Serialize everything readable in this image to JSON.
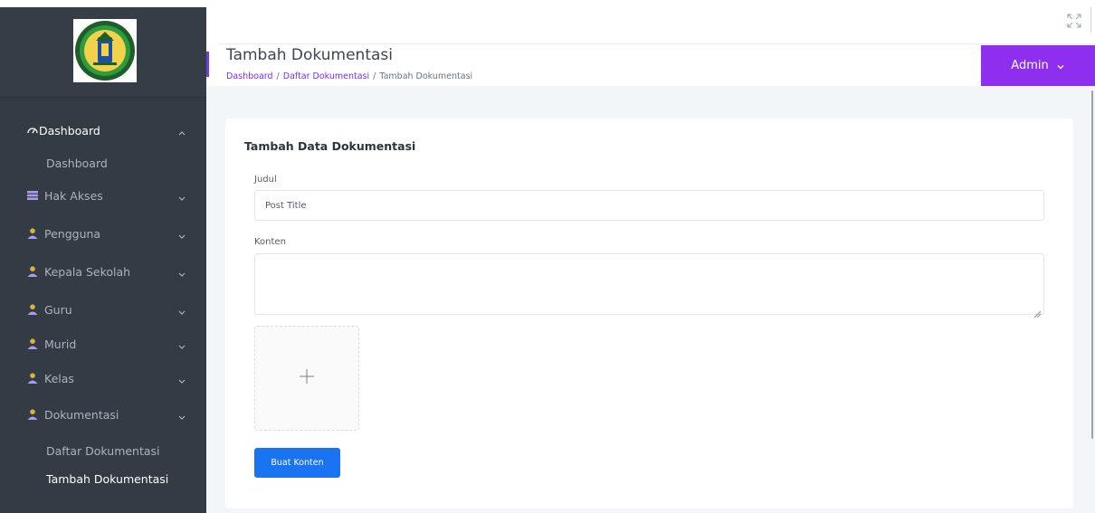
{
  "header": {
    "page_title": "Tambah Dokumentasi",
    "breadcrumb": [
      {
        "label": "Dashboard",
        "link": true
      },
      {
        "label": "Daftar Dokumentasi",
        "link": true
      },
      {
        "label": "Tambah Dokumentasi",
        "link": false
      }
    ],
    "breadcrumb_separator": "/",
    "user_menu_label": "Admin"
  },
  "sidebar": {
    "items": [
      {
        "label": "Dashboard",
        "icon": "dashboard-icon"
      },
      {
        "label": "Hak Akses",
        "icon": "list-icon"
      },
      {
        "label": "Pengguna",
        "icon": "user-icon"
      },
      {
        "label": "Kepala Sekolah",
        "icon": "user-icon"
      },
      {
        "label": "Guru",
        "icon": "user-icon"
      },
      {
        "label": "Murid",
        "icon": "user-icon"
      },
      {
        "label": "Kelas",
        "icon": "user-icon"
      },
      {
        "label": "Dokumentasi",
        "icon": "user-icon"
      }
    ],
    "dashboard_sub": [
      "Dashboard"
    ],
    "dokumentasi_sub": [
      "Daftar Dokumentasi",
      "Tambah Dokumentasi"
    ]
  },
  "form": {
    "card_title": "Tambah Data Dokumentasi",
    "judul_label": "Judul",
    "judul_placeholder": "Post Title",
    "judul_value": "",
    "konten_label": "Konten",
    "konten_value": "",
    "upload_icon": "plus-icon",
    "submit_label": "Buat Konten"
  },
  "colors": {
    "sidebar_bg": "#333b44",
    "accent_purple": "#8e2ff0",
    "link_purple": "#7b2cf5",
    "primary_blue": "#1a73f0",
    "icon_purple": "#a99cf0",
    "icon_gold": "#d9b43c"
  }
}
